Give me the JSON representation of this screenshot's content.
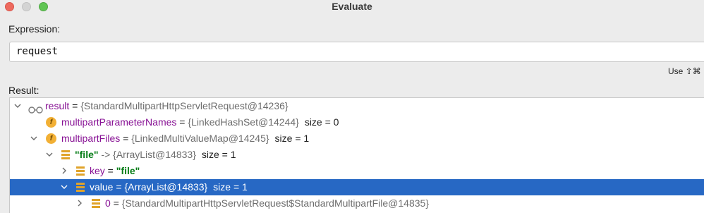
{
  "window": {
    "title": "Evaluate",
    "colors": {
      "close": "#ed6a5e",
      "minimize": "#d4d4d4",
      "zoom": "#61c554",
      "selection": "#2768c4"
    }
  },
  "expression": {
    "label": "Expression:",
    "value": "request"
  },
  "hint": "Use ⇧⌘",
  "result": {
    "label": "Result:",
    "rows": [
      {
        "name": "result",
        "eq": " = ",
        "value": "{StandardMultipartHttpServletRequest@14236}",
        "size": "",
        "icon": "watch-icon",
        "expanded": true
      },
      {
        "name": "multipartParameterNames",
        "eq": " = ",
        "value": "{LinkedHashSet@14244}",
        "size": "size = 0",
        "icon": "field-icon",
        "expanded": null
      },
      {
        "name": "multipartFiles",
        "eq": " = ",
        "value": "{LinkedMultiValueMap@14245}",
        "size": "size = 1",
        "icon": "field-icon",
        "expanded": true
      },
      {
        "name": "\"file\"",
        "eq": " -> ",
        "value": "{ArrayList@14833}",
        "size": "size = 1",
        "icon": "list-icon",
        "expanded": true
      },
      {
        "name": "key",
        "eq": " = ",
        "value": "\"file\"",
        "size": "",
        "icon": "list-icon",
        "expanded": false
      },
      {
        "name": "value",
        "eq": " = ",
        "value": "{ArrayList@14833}",
        "size": "size = 1",
        "icon": "list-icon",
        "expanded": true,
        "selected": true
      },
      {
        "name": "0",
        "eq": " = ",
        "value": "{StandardMultipartHttpServletRequest$StandardMultipartFile@14835}",
        "size": "",
        "icon": "list-icon",
        "expanded": false
      }
    ]
  }
}
